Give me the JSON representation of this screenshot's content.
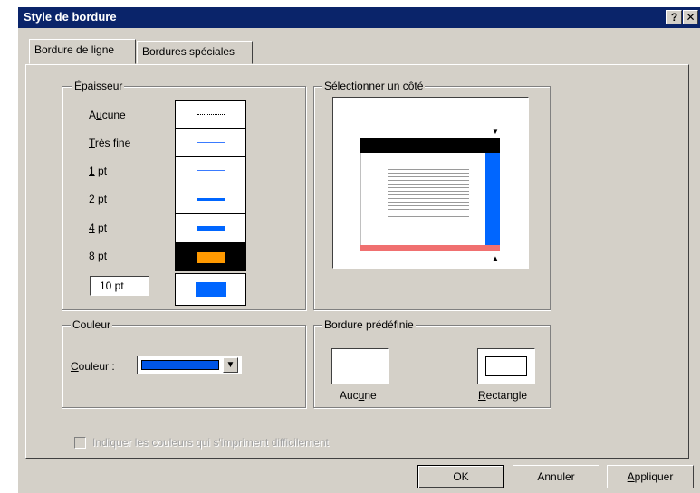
{
  "window": {
    "title": "Style de bordure",
    "help_label": "?",
    "close_label": "✕"
  },
  "tabs": [
    {
      "label": "Bordure de ligne",
      "selected": true
    },
    {
      "label": "Bordures spéciales",
      "selected": false
    }
  ],
  "epaisseur": {
    "title": "Épaisseur",
    "items": [
      {
        "label": "Aucune",
        "mnemonic": "u"
      },
      {
        "label": "Très fine",
        "mnemonic": "T"
      },
      {
        "label": "1 pt",
        "mnemonic": "1"
      },
      {
        "label": "2 pt",
        "mnemonic": "2"
      },
      {
        "label": "4 pt",
        "mnemonic": "4"
      },
      {
        "label": "8 pt",
        "mnemonic": "8"
      }
    ],
    "custom_value": "10 pt"
  },
  "side": {
    "title": "Sélectionner un côté"
  },
  "couleur": {
    "title": "Couleur",
    "label": "Couleur :",
    "value_color": "#0055e6"
  },
  "predefined": {
    "title": "Bordure prédéfinie",
    "none_label": "Aucune",
    "rect_label": "Rectangle"
  },
  "checkbox": {
    "label": "Indiquer les couleurs qui s'impriment difficilement",
    "checked": false,
    "enabled": false
  },
  "buttons": {
    "ok": "OK",
    "cancel": "Annuler",
    "apply": "Appliquer"
  },
  "colors": {
    "title_bar": "#0a246a",
    "face": "#d4d0c8",
    "blue": "#0066ff",
    "orange": "#ff9900",
    "pink": "#f07070"
  }
}
